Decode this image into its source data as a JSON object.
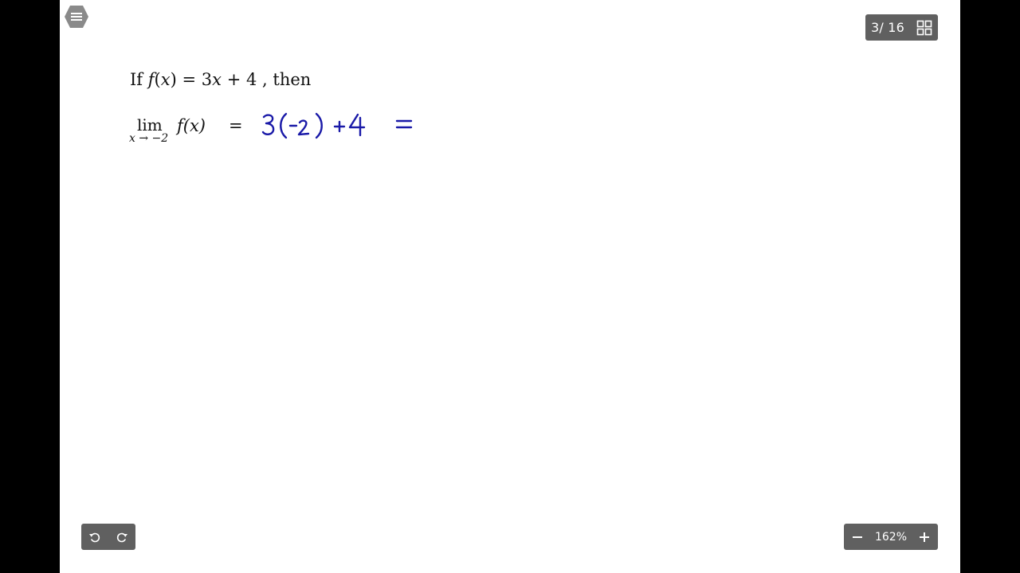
{
  "toolbar": {
    "page_counter": "3/ 16",
    "zoom_level": "162%",
    "accent_color": "#606060"
  },
  "icons": [
    "menu-icon",
    "grid-view-icon",
    "undo-icon",
    "redo-icon",
    "zoom-out-icon",
    "zoom-in-icon"
  ],
  "content": {
    "line1": {
      "prefix": "If",
      "func": "f",
      "lparen": "(",
      "var": "x",
      "rparen": ")",
      "rhs_eq": "=",
      "rhs_num": "3",
      "rhs_var": "x",
      "rhs_plus": "+",
      "rhs_const": "4",
      "suffix": ", then"
    },
    "limit": {
      "lim": "lim",
      "subscript": "x → −2",
      "expr": "f(x)",
      "equals": "="
    },
    "handwriting": {
      "text": "3(−2)+4 =",
      "color": "#1a1aa8"
    }
  }
}
